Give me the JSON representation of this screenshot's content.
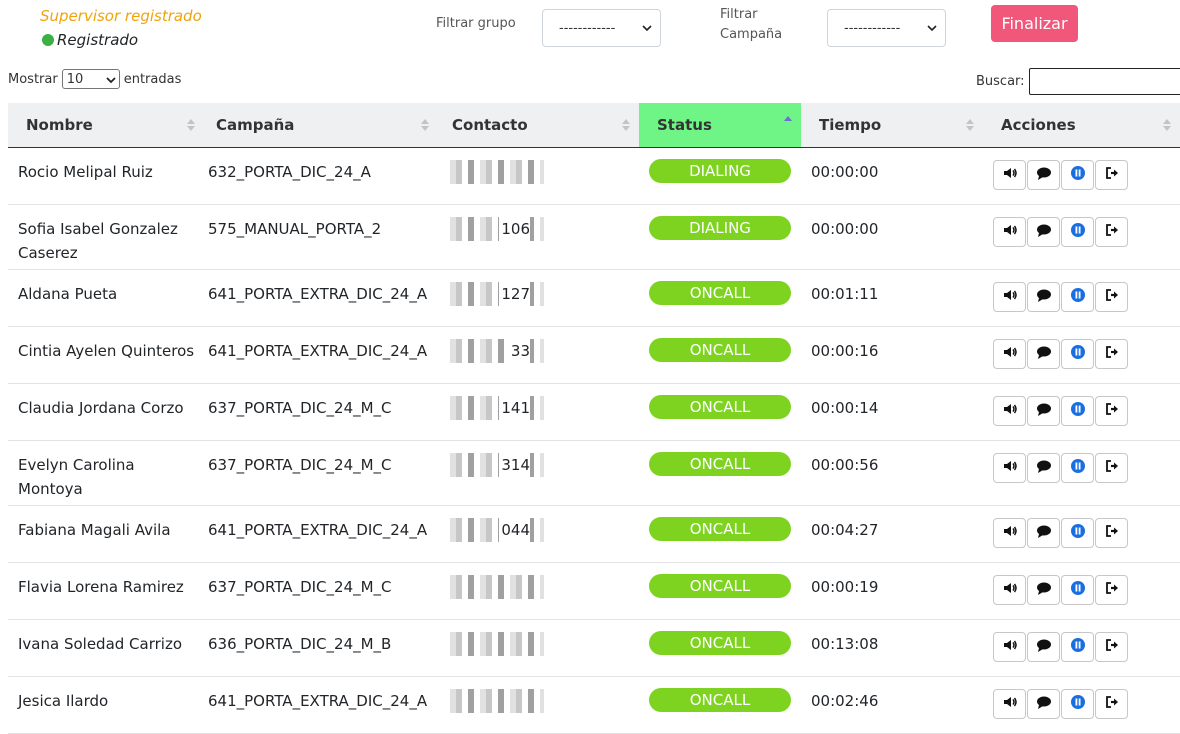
{
  "supervisor": {
    "title": "Supervisor registrado",
    "status": "Registrado"
  },
  "filters": {
    "group_label": "Filtrar grupo",
    "group_value": "------------",
    "campaign_label_1": "Filtrar",
    "campaign_label_2": "Campaña",
    "campaign_value": "------------"
  },
  "finalize_label": "Finalizar",
  "length": {
    "prefix": "Mostrar",
    "value": "10",
    "suffix": "entradas"
  },
  "search": {
    "label": "Buscar:",
    "value": ""
  },
  "columns": [
    "Nombre",
    "Campaña",
    "Contacto",
    "Status",
    "Tiempo",
    "Acciones"
  ],
  "rows": [
    {
      "name1": "Rocio Melipal Ruiz",
      "name2": "",
      "campaign": "632_PORTA_DIC_24_A",
      "contact_tail": "",
      "status": "DIALING",
      "time": "00:00:00"
    },
    {
      "name1": "Sofia Isabel Gonzalez",
      "name2": "Caserez",
      "campaign": "575_MANUAL_PORTA_2",
      "contact_tail": "106",
      "status": "DIALING",
      "time": "00:00:00"
    },
    {
      "name1": "Aldana Pueta",
      "name2": "",
      "campaign": "641_PORTA_EXTRA_DIC_24_A",
      "contact_tail": "127",
      "status": "ONCALL",
      "time": "00:01:11"
    },
    {
      "name1": "Cintia Ayelen Quinteros",
      "name2": "",
      "campaign": "641_PORTA_EXTRA_DIC_24_A",
      "contact_tail": "33",
      "status": "ONCALL",
      "time": "00:00:16"
    },
    {
      "name1": "Claudia Jordana Corzo",
      "name2": "",
      "campaign": "637_PORTA_DIC_24_M_C",
      "contact_tail": "141",
      "status": "ONCALL",
      "time": "00:00:14"
    },
    {
      "name1": "Evelyn Carolina",
      "name2": "Montoya",
      "campaign": "637_PORTA_DIC_24_M_C",
      "contact_tail": "314",
      "status": "ONCALL",
      "time": "00:00:56"
    },
    {
      "name1": "Fabiana Magali Avila",
      "name2": "",
      "campaign": "641_PORTA_EXTRA_DIC_24_A",
      "contact_tail": "044",
      "status": "ONCALL",
      "time": "00:04:27"
    },
    {
      "name1": "Flavia Lorena Ramirez",
      "name2": "",
      "campaign": "637_PORTA_DIC_24_M_C",
      "contact_tail": "",
      "status": "ONCALL",
      "time": "00:00:19"
    },
    {
      "name1": "Ivana Soledad Carrizo",
      "name2": "",
      "campaign": "636_PORTA_DIC_24_M_B",
      "contact_tail": "",
      "status": "ONCALL",
      "time": "00:13:08"
    },
    {
      "name1": "Jesica Ilardo",
      "name2": "",
      "campaign": "641_PORTA_EXTRA_DIC_24_A",
      "contact_tail": "",
      "status": "ONCALL",
      "time": "00:02:46"
    }
  ],
  "icons": [
    "volume-icon",
    "chat-icon",
    "pause-icon",
    "logout-icon"
  ],
  "colors": {
    "status_badge": "#7ed321",
    "active_header": "#6ef585",
    "finalize": "#f0577a",
    "supervisor": "#f0a30a",
    "registered_dot": "#3cb043"
  }
}
